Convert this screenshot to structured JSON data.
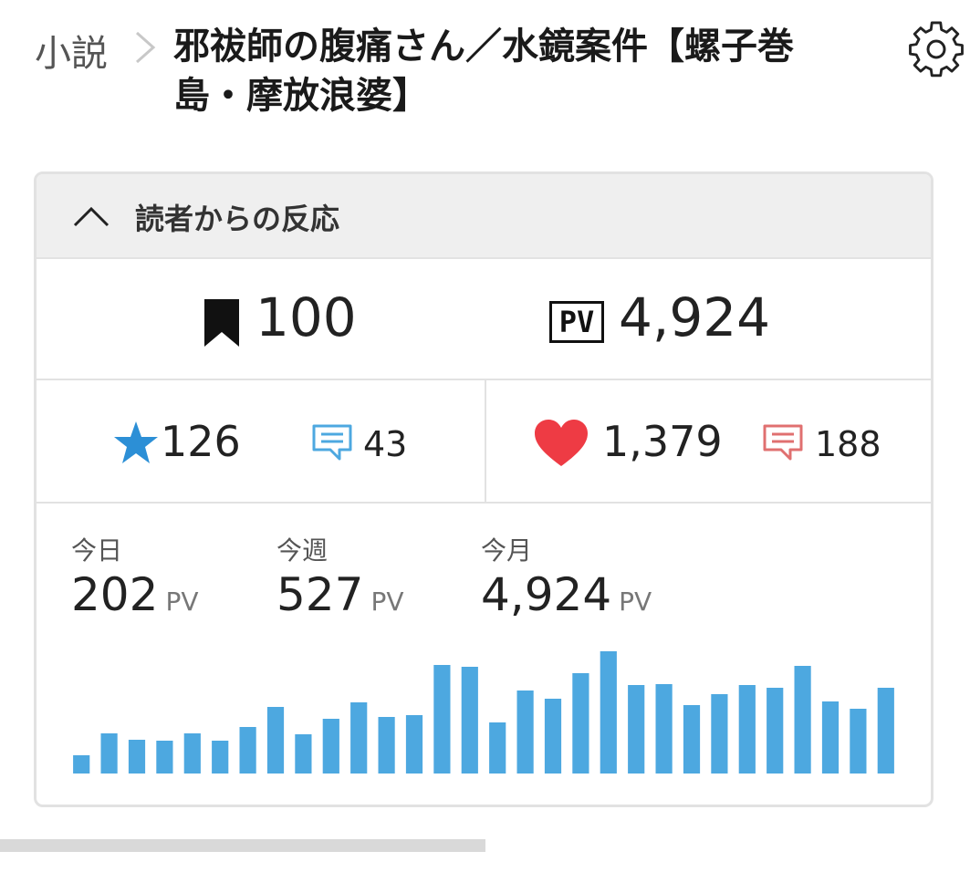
{
  "breadcrumb": {
    "root": "小説",
    "title": "邪祓師の腹痛さん／水鏡案件【螺子巻島・摩放浪婆】"
  },
  "panel": {
    "heading": "読者からの反応"
  },
  "metrics": {
    "bookmarks": "100",
    "pv_icon_text": "PV",
    "page_views": "4,924",
    "stars": "126",
    "star_comments": "43",
    "likes": "1,379",
    "like_comments": "188"
  },
  "stats": {
    "today": {
      "label": "今日",
      "value": "202",
      "unit": "PV"
    },
    "week": {
      "label": "今週",
      "value": "527",
      "unit": "PV"
    },
    "month": {
      "label": "今月",
      "value": "4,924",
      "unit": "PV"
    }
  },
  "colors": {
    "accent_blue": "#4da8e0",
    "heart_red": "#ee3b44",
    "comment_red": "#e07070",
    "bar_blue": "#4da8e0"
  },
  "icons": [
    "chevron-right-icon",
    "gear-icon",
    "chevron-up-icon",
    "bookmark-icon",
    "pv-icon",
    "star-icon",
    "comment-icon",
    "heart-icon"
  ],
  "chart_data": {
    "type": "bar",
    "values": [
      20,
      44,
      37,
      36,
      44,
      36,
      51,
      73,
      43,
      60,
      78,
      62,
      64,
      119,
      117,
      56,
      91,
      82,
      110,
      134,
      97,
      98,
      75,
      87,
      97,
      94,
      118,
      79,
      71,
      94
    ],
    "ylim": [
      0,
      136
    ]
  }
}
